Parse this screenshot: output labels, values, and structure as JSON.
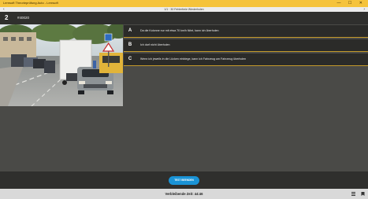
{
  "window": {
    "title": "Lernsoft Theorieprüfung Auto - Lernsoft",
    "controls": "— ☐ ✕"
  },
  "nav": {
    "back_icon": "‹",
    "center": "1/1 · 30 Fehlerfreie Wiederholen",
    "forward_icon": "›"
  },
  "question": {
    "number": "2",
    "code": "#40020"
  },
  "answers": [
    {
      "letter": "A",
      "text": "Da die Kolonne nur mit etwa 70 km/h fährt, kann ich überholen"
    },
    {
      "letter": "B",
      "text": "Ich darf nicht überholen"
    },
    {
      "letter": "C",
      "text": "Wenn ich jeweils in die Lücken einbiege, kann ich Fahrzeug um Fahrzeug überholen"
    }
  ],
  "test_button": "TEST BEENDEN",
  "footer": {
    "timer": "Verbleibende Zeit: 44:46",
    "icons": [
      "grid-icon",
      "bookmark-icon"
    ]
  },
  "colors": {
    "titlebar": "#f5c33b",
    "accent_line": "#c49a2a",
    "button": "#1a93d6",
    "background": "#4a4a47"
  }
}
